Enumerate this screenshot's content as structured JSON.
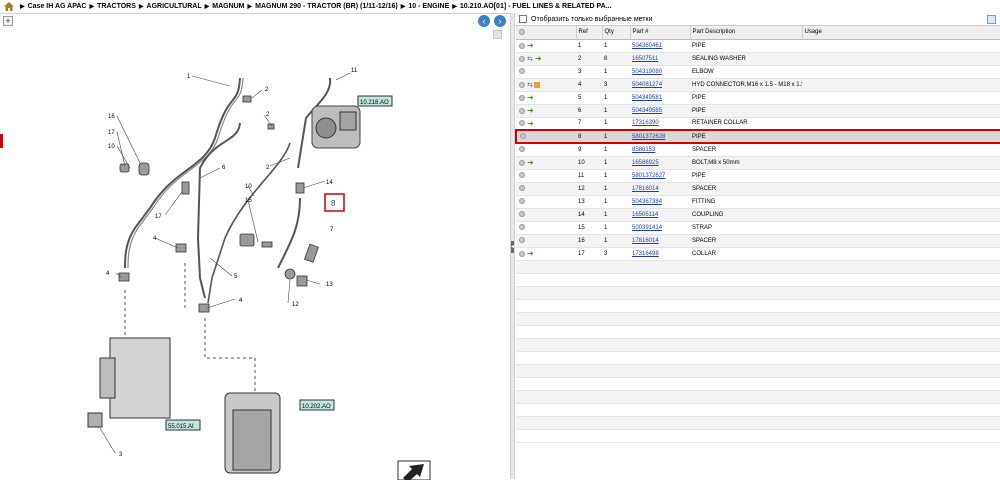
{
  "breadcrumb": [
    "Case IH AG APAC",
    "TRACTORS",
    "AGRICULTURAL",
    "MAGNUM",
    "MAGNUM 290 - TRACTOR (BR) (1/11-12/16)",
    "10 - ENGINE",
    "10.210.AO[01] - FUEL LINES & RELATED PA..."
  ],
  "filter": {
    "label": "Отобразить только выбранные метки"
  },
  "table": {
    "headers": {
      "ref": "Ref",
      "qty": "Qty",
      "part": "Part #",
      "desc": "Part Description",
      "usage": "Usage"
    },
    "rows": [
      {
        "ref": "1",
        "qty": "1",
        "part": "504360461",
        "desc": "PIPE",
        "icons": "arrow"
      },
      {
        "ref": "2",
        "qty": "8",
        "part": "16507511",
        "desc": "SEALING WASHER",
        "icons": "swap-arrow"
      },
      {
        "ref": "3",
        "qty": "1",
        "part": "504319080",
        "desc": "ELBOW",
        "icons": ""
      },
      {
        "ref": "4",
        "qty": "3",
        "part": "504081274",
        "desc": "HYD CONNECTOR,M16 x 1.5 - M18 x 1.5",
        "icons": "swap-box"
      },
      {
        "ref": "5",
        "qty": "1",
        "part": "504349581",
        "desc": "PIPE",
        "icons": "arrow"
      },
      {
        "ref": "6",
        "qty": "1",
        "part": "504349585",
        "desc": "PIPE",
        "icons": "arrow"
      },
      {
        "ref": "7",
        "qty": "1",
        "part": "17316390",
        "desc": "RETAINER COLLAR",
        "icons": "arrow"
      },
      {
        "ref": "8",
        "qty": "1",
        "part": "5801372628",
        "desc": "PIPE",
        "icons": "",
        "selected": true
      },
      {
        "ref": "9",
        "qty": "1",
        "part": "8580153",
        "desc": "SPACER",
        "icons": ""
      },
      {
        "ref": "10",
        "qty": "1",
        "part": "16586925",
        "desc": "BOLT,M8 x 50mm",
        "icons": "arrow"
      },
      {
        "ref": "11",
        "qty": "1",
        "part": "5801372627",
        "desc": "PIPE",
        "icons": ""
      },
      {
        "ref": "12",
        "qty": "1",
        "part": "17816014",
        "desc": "SPACER",
        "icons": ""
      },
      {
        "ref": "13",
        "qty": "1",
        "part": "504367384",
        "desc": "FITTING",
        "icons": ""
      },
      {
        "ref": "14",
        "qty": "1",
        "part": "16505114",
        "desc": "COUPLING",
        "icons": ""
      },
      {
        "ref": "15",
        "qty": "1",
        "part": "500391414",
        "desc": "STRAP",
        "icons": ""
      },
      {
        "ref": "16",
        "qty": "1",
        "part": "17816014",
        "desc": "SPACER",
        "icons": ""
      },
      {
        "ref": "17",
        "qty": "3",
        "part": "17316498",
        "desc": "COLLAR",
        "icons": "arrow"
      }
    ]
  },
  "diagram": {
    "callouts": [
      "1",
      "2",
      "2",
      "16",
      "17",
      "10",
      "11",
      "6",
      "2",
      "14",
      "15",
      "10",
      "8",
      "7",
      "17",
      "4",
      "4",
      "5",
      "9",
      "13",
      "12",
      "4",
      "3"
    ],
    "refboxes": [
      "10.218.AO",
      "55.015.AI",
      "10.202.AO"
    ]
  },
  "colors": {
    "accent": "#3e7fc1",
    "highlight": "#d10000",
    "link": "#1a3fb8",
    "refbox": "#bfe6df"
  }
}
